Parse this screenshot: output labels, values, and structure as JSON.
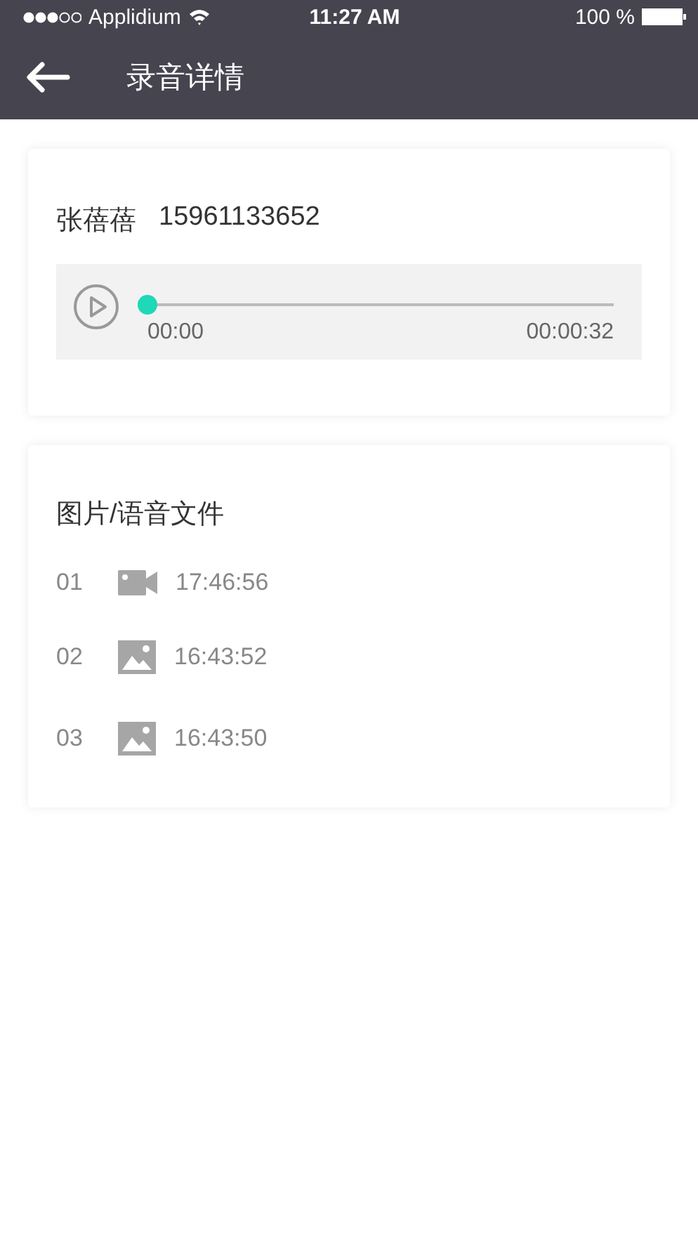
{
  "status_bar": {
    "carrier": "Applidium",
    "time": "11:27 AM",
    "battery": "100 %"
  },
  "header": {
    "title": "录音详情"
  },
  "recording": {
    "name": "张蓓蓓",
    "phone": "15961133652",
    "level": 0,
    "elapsed": "00:00",
    "duration": "00:00:32"
  },
  "files": {
    "title": "图片/语音文件",
    "items": [
      {
        "index": "01",
        "kind": "video",
        "time": "17:46:56"
      },
      {
        "index": "02",
        "kind": "image",
        "time": "16:43:52"
      },
      {
        "index": "03",
        "kind": "image",
        "time": "16:43:50"
      }
    ]
  }
}
